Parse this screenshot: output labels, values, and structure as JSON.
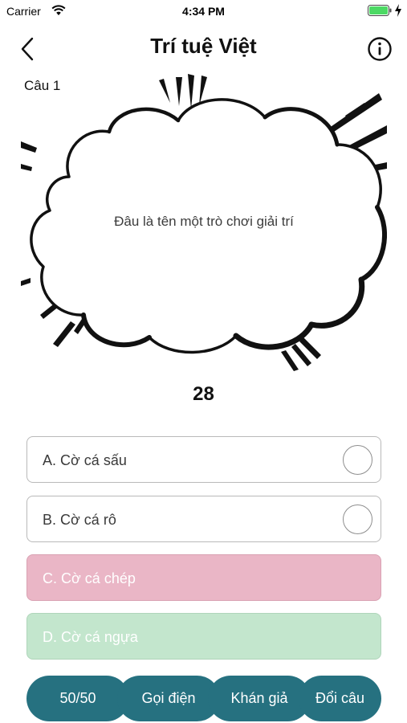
{
  "status_bar": {
    "carrier": "Carrier",
    "time": "4:34 PM"
  },
  "nav": {
    "title": "Trí tuệ Việt",
    "back_icon": "chevron-left-icon",
    "info_icon": "info-circle-icon"
  },
  "question": {
    "number_label": "Câu 1",
    "text": "Đâu là tên một trò chơi giải trí"
  },
  "timer": {
    "value": "28"
  },
  "answers": [
    {
      "label": "A. Cờ cá sấu",
      "state": "default"
    },
    {
      "label": "B. Cờ cá rô",
      "state": "default"
    },
    {
      "label": "C. Cờ cá chép",
      "state": "eliminated",
      "color": "#eab6c6"
    },
    {
      "label": "D. Cờ cá ngựa",
      "state": "highlighted",
      "color": "#c3e6cd"
    }
  ],
  "lifelines": [
    {
      "label": "50/50"
    },
    {
      "label": "Gọi điện"
    },
    {
      "label": "Khán giả"
    },
    {
      "label": "Đổi câu"
    }
  ],
  "colors": {
    "lifeline": "#267180",
    "answer_pink": "#eab6c6",
    "answer_green": "#c3e6cd"
  }
}
